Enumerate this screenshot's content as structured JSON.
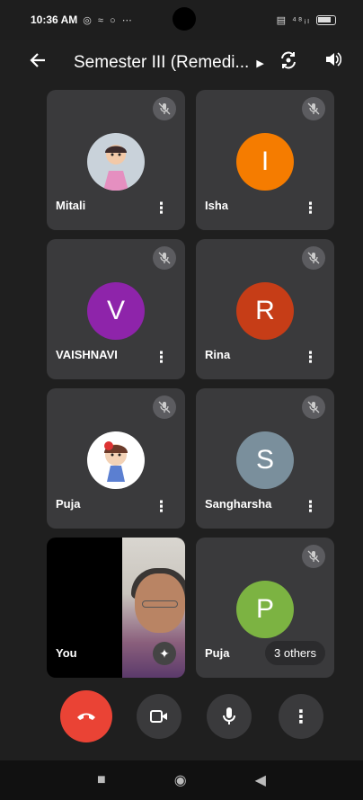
{
  "status_bar": {
    "time": "10:36 AM",
    "status_icons": "◎ ≈ ○ ⋯",
    "signal": "▤ ⁴⁸ᵢₗ"
  },
  "top_bar": {
    "title": "Semester III (Remedi...",
    "caret": "▶"
  },
  "participants": [
    {
      "name": "Mitali",
      "initial": "",
      "avatar_color": "#c9d2da",
      "muted": true
    },
    {
      "name": "Isha",
      "initial": "I",
      "avatar_color": "#f57c00",
      "muted": true
    },
    {
      "name": "VAISHNAVI",
      "initial": "V",
      "avatar_color": "#8e24aa",
      "muted": true
    },
    {
      "name": "Rina",
      "initial": "R",
      "avatar_color": "#c63d17",
      "muted": true
    },
    {
      "name": "Puja",
      "initial": "",
      "avatar_color": "#ffffff",
      "muted": true
    },
    {
      "name": "Sangharsha",
      "initial": "S",
      "avatar_color": "#7a8f9c",
      "muted": true
    },
    {
      "name": "You",
      "initial": "",
      "avatar_color": "",
      "muted": false
    },
    {
      "name": "Puja",
      "initial": "P",
      "avatar_color": "#7cb342",
      "muted": true
    }
  ],
  "others_label": "3 others",
  "colors": {
    "background": "#1f1f1f",
    "tile": "#3a3a3c",
    "end_call": "#ea4335"
  }
}
